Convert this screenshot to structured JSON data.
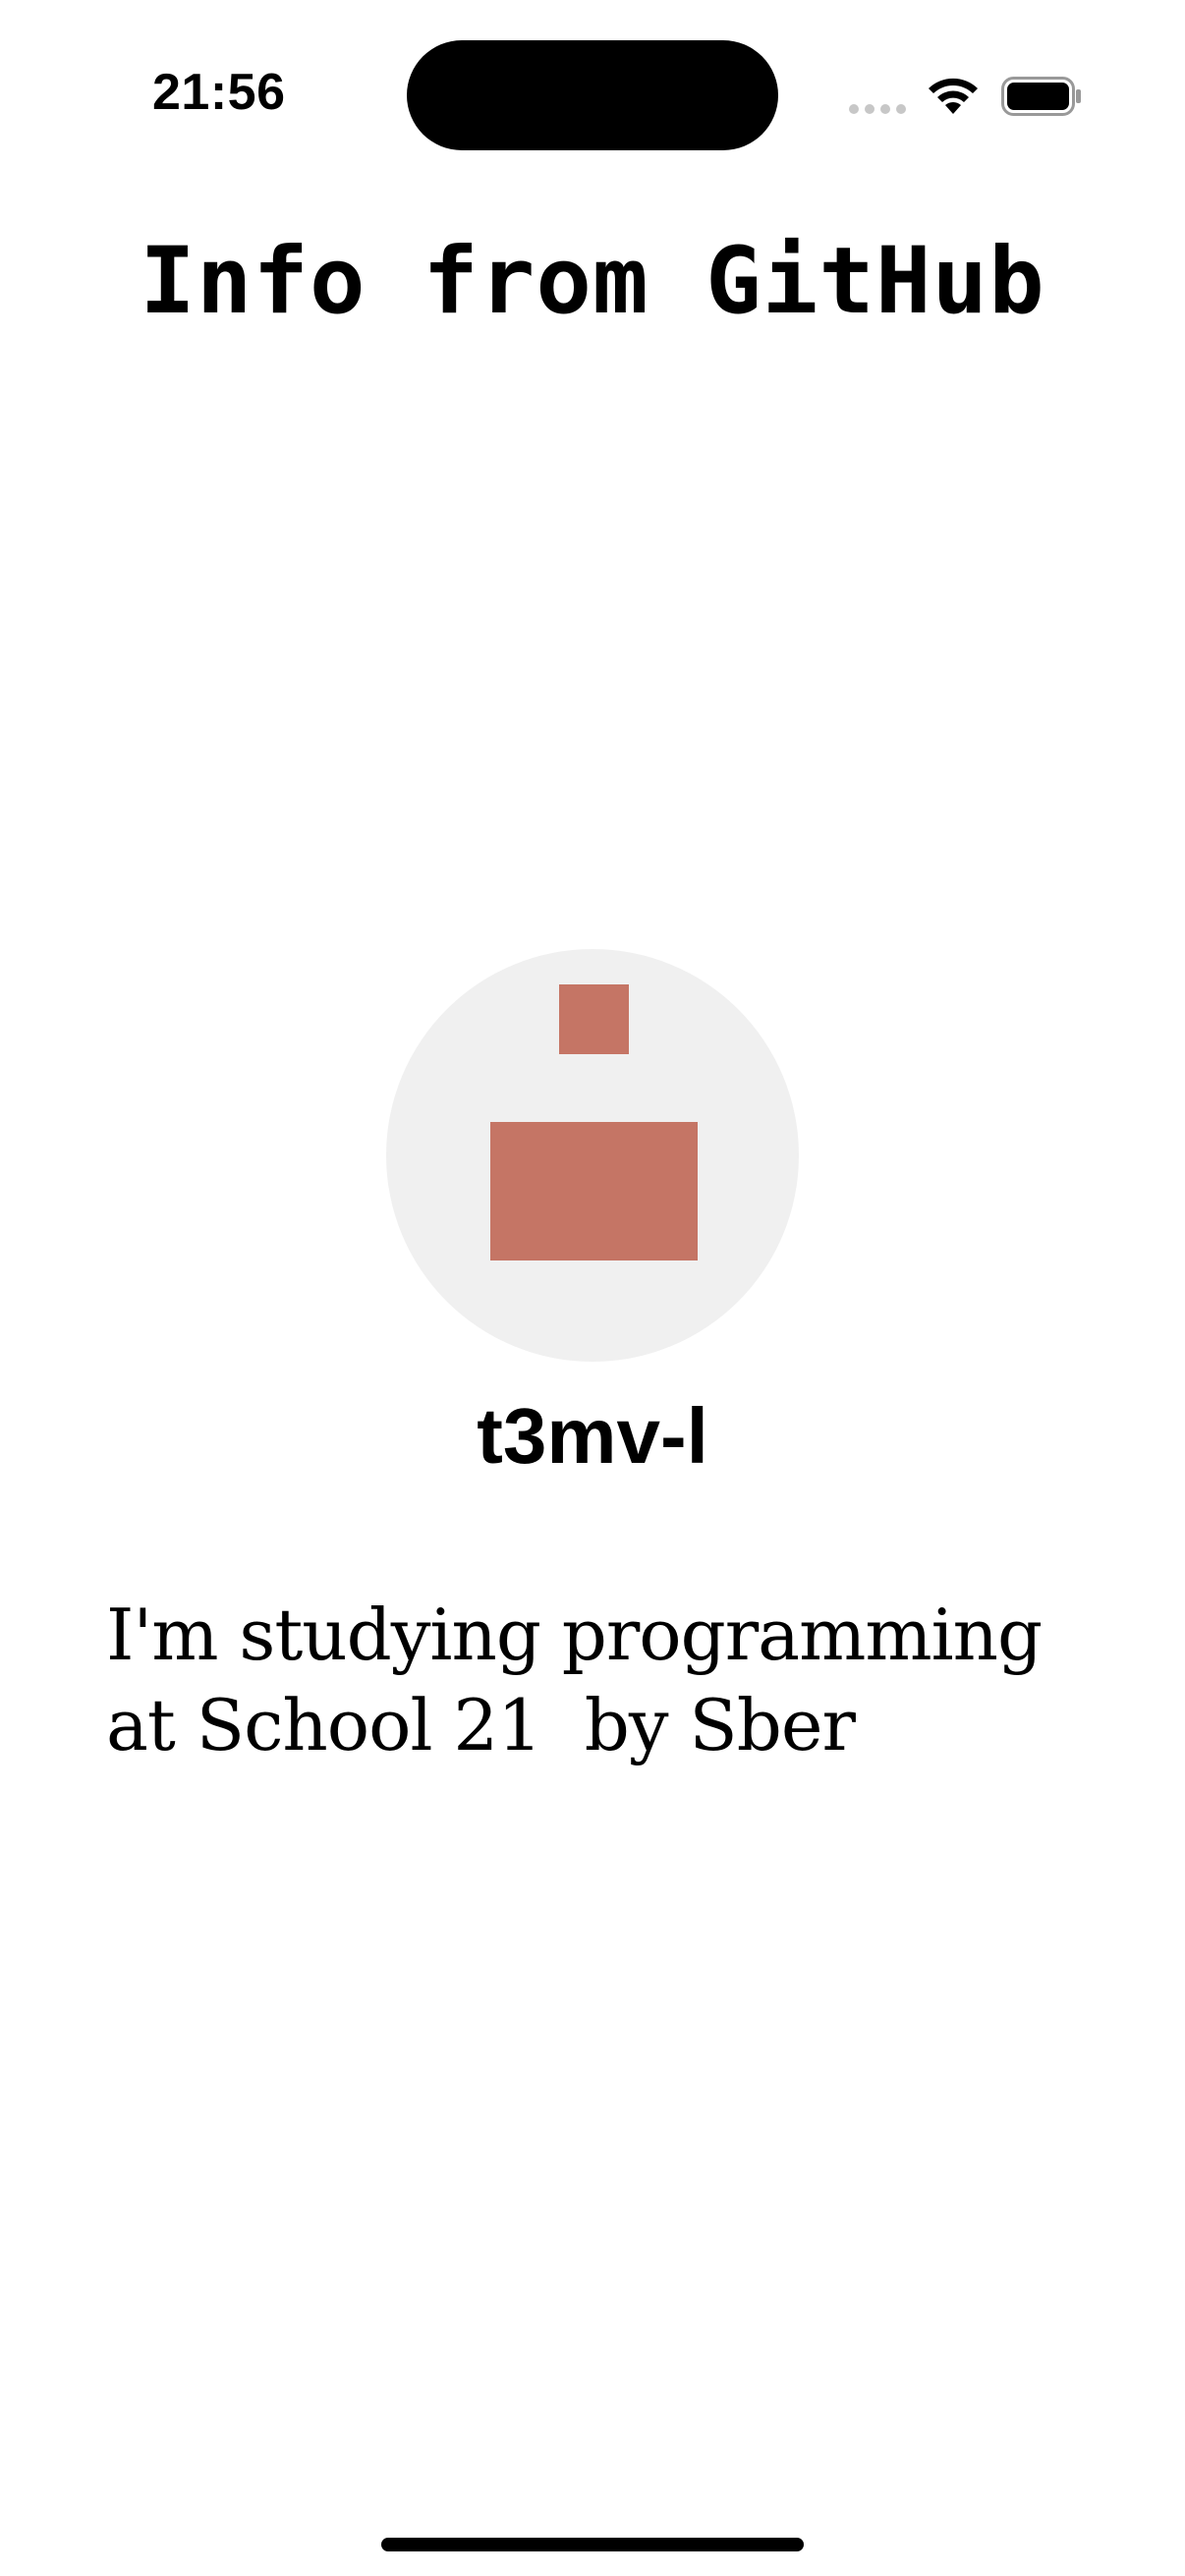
{
  "status_bar": {
    "time": "21:56",
    "icons": [
      "cellular-signal-icon",
      "wifi-icon",
      "battery-icon"
    ]
  },
  "page": {
    "title": "Info from GitHub"
  },
  "profile": {
    "avatar_icon": "identicon-avatar-icon",
    "avatar_color": "#c57565",
    "avatar_background": "#f0f0f0",
    "username": "t3mv-l",
    "bio": "I'm studying programming\nat School 21  by Sber"
  }
}
